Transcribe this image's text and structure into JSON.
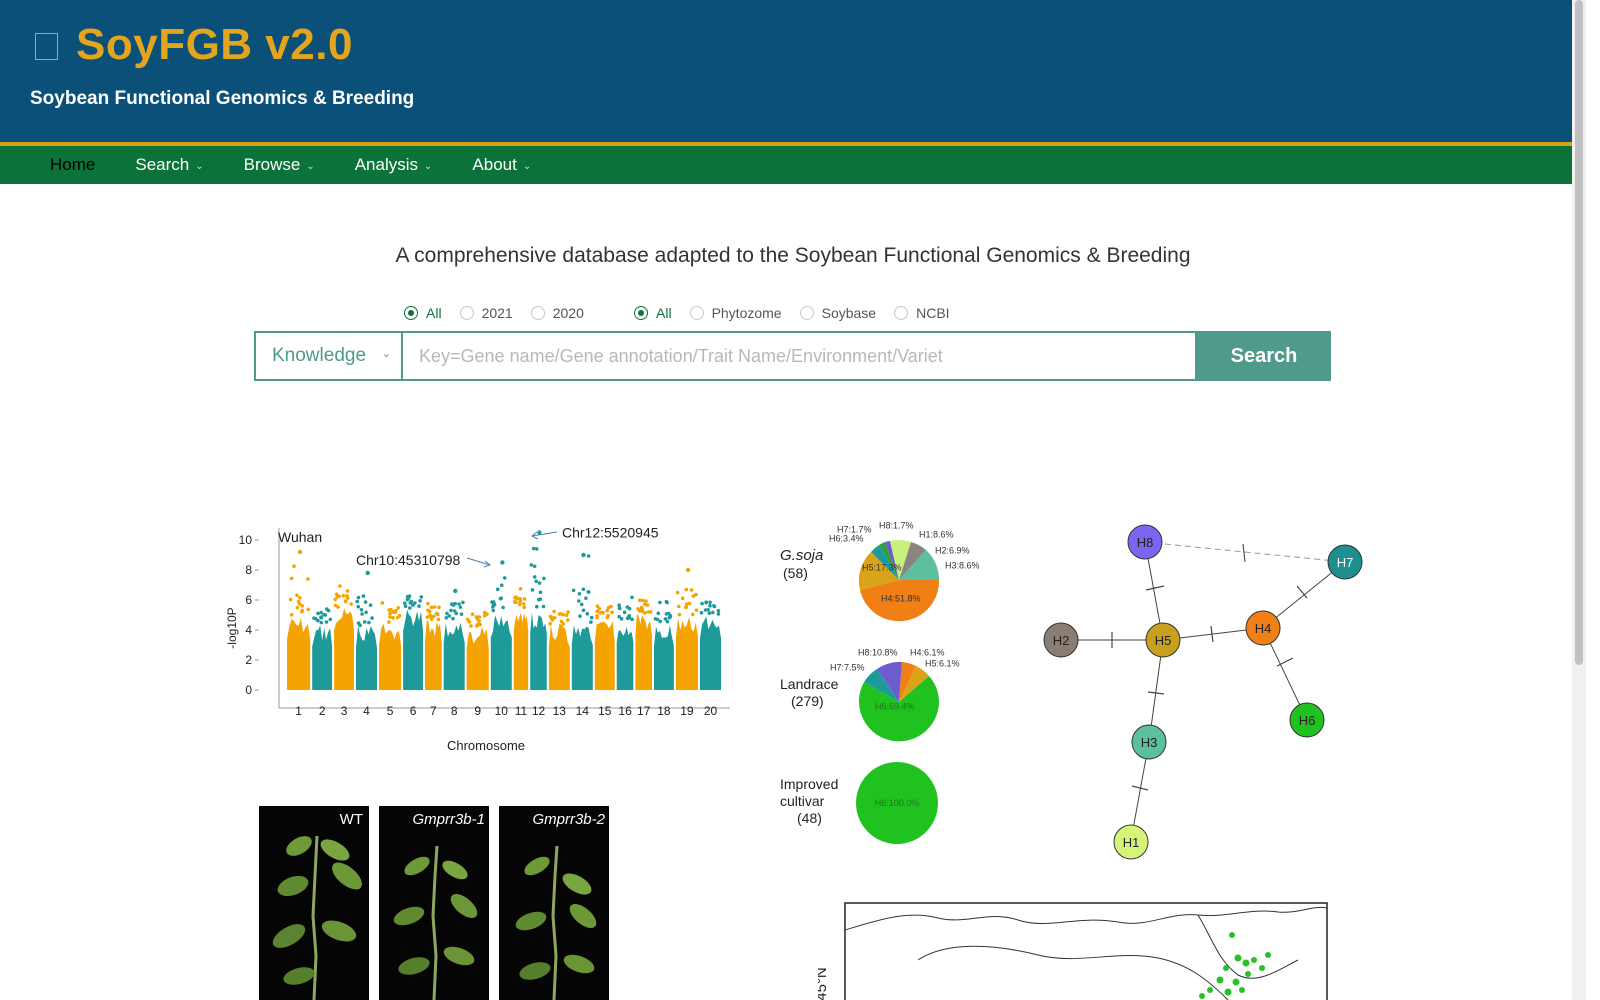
{
  "header": {
    "title": "SoyFGB v2.0",
    "subtitle": "Soybean Functional Genomics & Breeding",
    "logo_icon": "square-icon"
  },
  "nav": {
    "items": [
      {
        "label": "Home",
        "active": true
      },
      {
        "label": "Search",
        "dropdown": true
      },
      {
        "label": "Browse",
        "dropdown": true
      },
      {
        "label": "Analysis",
        "dropdown": true
      },
      {
        "label": "About",
        "dropdown": true
      }
    ]
  },
  "main": {
    "tagline": "A comprehensive database adapted to the Soybean Functional Genomics & Breeding",
    "year_filter": [
      "All",
      "2021",
      "2020"
    ],
    "year_selected": "All",
    "source_filter": [
      "All",
      "Phytozome",
      "Soybase",
      "NCBI"
    ],
    "source_selected": "All",
    "search": {
      "category": "Knowledge",
      "placeholder": "Key=Gene name/Gene annotation/Trait Name/Environment/Variet",
      "button_label": "Search"
    }
  },
  "figures": {
    "manhattan": {
      "location": "Wuhan",
      "xlabel": "Chromosome",
      "ylabel": "-log10P",
      "y_ticks": [
        "10",
        "8",
        "6",
        "4",
        "2",
        "0"
      ],
      "chromosomes": [
        "1",
        "2",
        "3",
        "4",
        "5",
        "6",
        "7",
        "8",
        "9",
        "10",
        "11",
        "12",
        "13",
        "14",
        "15",
        "16",
        "17",
        "18",
        "19",
        "20"
      ],
      "annotations": [
        "Chr10:45310798",
        "Chr12:5520945"
      ],
      "colors": [
        "#f5a300",
        "#1e9a9a"
      ]
    },
    "haplotype_pies": [
      {
        "group": "G.soja",
        "count": "(58)",
        "labels": [
          "H8:1.7%",
          "H1:8.6%",
          "H7:1.7%",
          "H6:3.4%",
          "H2:6.9%",
          "H3:8.6%",
          "H5:17.3%",
          "H4:51.8%"
        ]
      },
      {
        "group": "Landrace",
        "count": "(279)",
        "labels": [
          "H8:10.8%",
          "H4:6.1%",
          "H5:6.1%",
          "H7:7.5%",
          "H6:69.4%"
        ]
      },
      {
        "group": "Improved cultivar",
        "group_lines": [
          "Improved",
          "cultivar"
        ],
        "count": "(48)",
        "labels": [
          "H6:100.0%"
        ]
      }
    ],
    "network": {
      "nodes": [
        "H8",
        "H7",
        "H2",
        "H5",
        "H4",
        "H6",
        "H3",
        "H1"
      ]
    },
    "plants": [
      "WT",
      "Gmprr3b-1",
      "Gmprr3b-2"
    ],
    "map": {
      "lat_label": "45°N"
    }
  }
}
